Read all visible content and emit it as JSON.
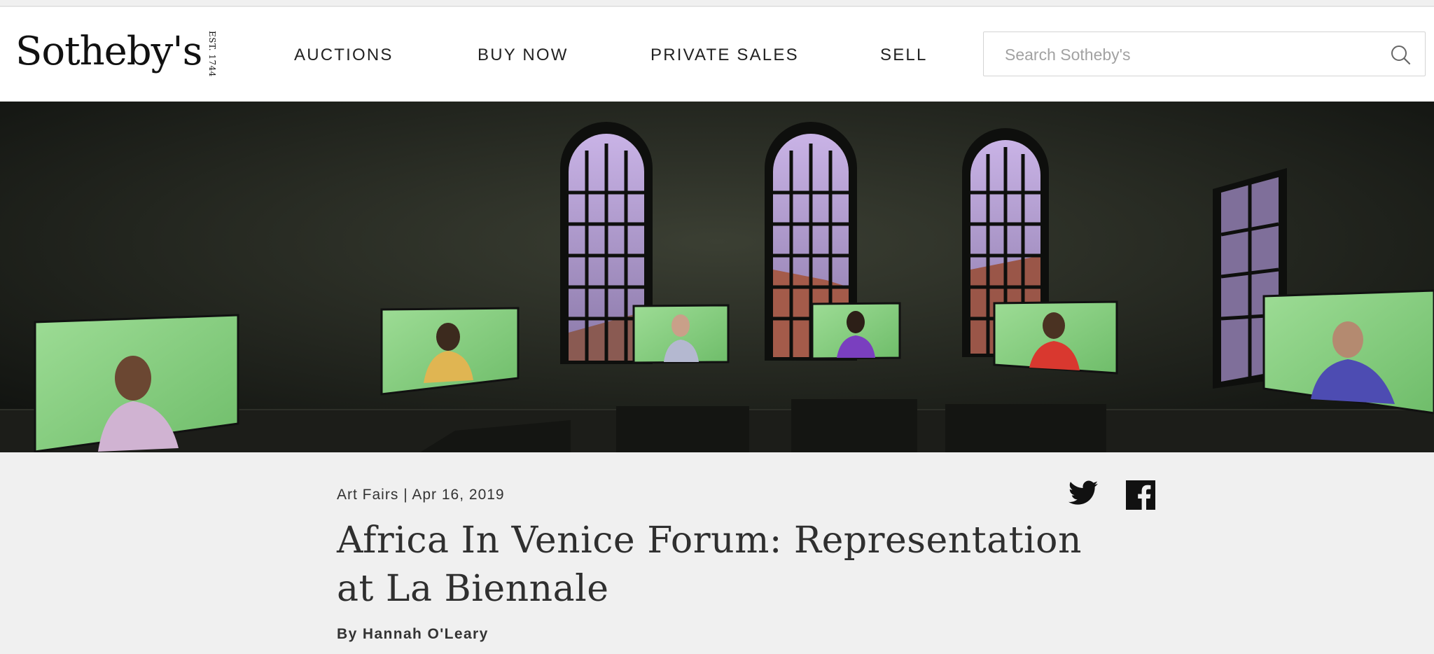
{
  "header": {
    "logo_text": "Sotheby's",
    "logo_est": "EST. 1744",
    "nav": [
      "AUCTIONS",
      "BUY NOW",
      "PRIVATE SALES",
      "SELL"
    ],
    "search": {
      "placeholder": "Search Sotheby's",
      "value": ""
    },
    "icons": {
      "search": "search-icon"
    }
  },
  "hero": {
    "icon": "hero-image-installation-room-with-screens"
  },
  "article": {
    "category": "Art Fairs",
    "separator": "|",
    "date": "Apr 16, 2019",
    "title": "Africa In Venice Forum: Representation at La Biennale",
    "author": "By Hannah O'Leary",
    "share_icons": [
      "twitter-icon",
      "facebook-icon"
    ]
  },
  "colors": {
    "text_dark": "#2f2f2f",
    "background": "#f0f0f0",
    "screen_green": "#8fd48a"
  }
}
